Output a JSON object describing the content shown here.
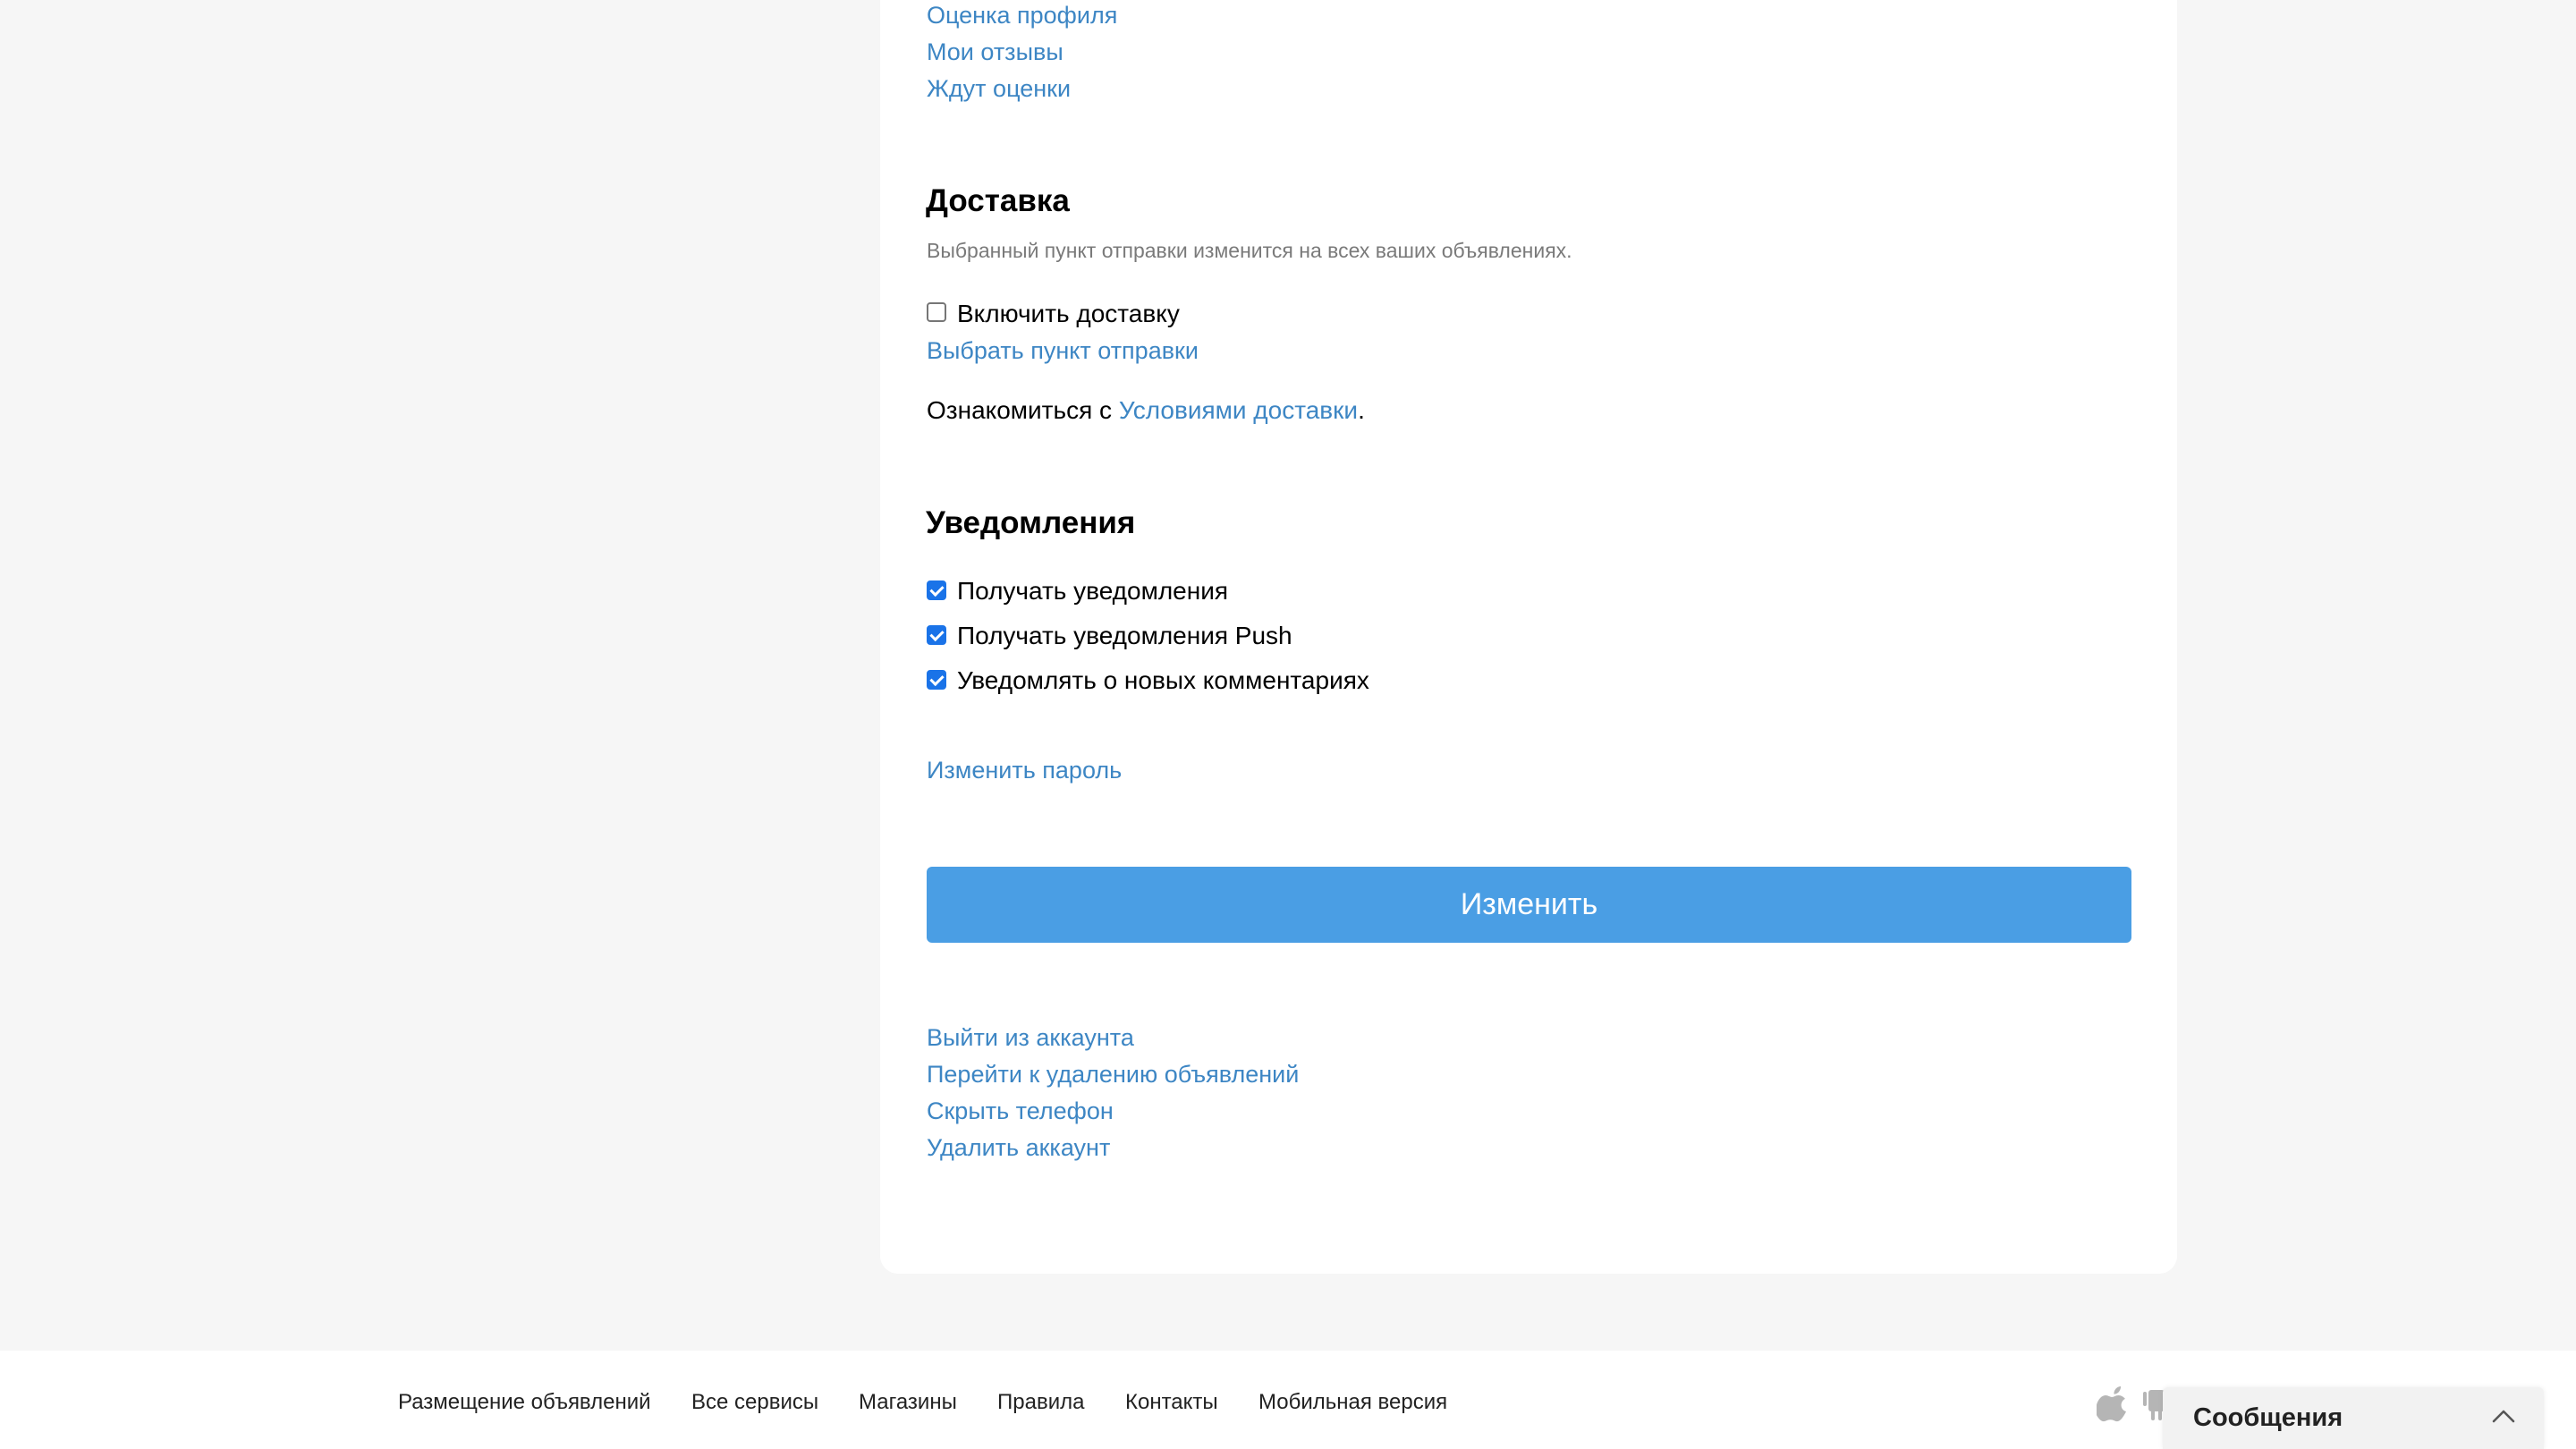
{
  "reviews": {
    "profile_rating": "Оценка профиля",
    "my_reviews": "Мои отзывы",
    "awaiting_rating": "Ждут оценки"
  },
  "delivery": {
    "title": "Доставка",
    "note": "Выбранный пункт отправки изменится на всех ваших объявлениях.",
    "enable_label": "Включить доставку",
    "enable_checked": false,
    "choose_point": "Выбрать пункт отправки",
    "terms_prefix": "Ознакомиться с ",
    "terms_link": "Условиями доставки",
    "terms_suffix": "."
  },
  "notifications": {
    "title": "Уведомления",
    "items": [
      {
        "label": "Получать уведомления",
        "checked": true
      },
      {
        "label": "Получать уведомления Push",
        "checked": true
      },
      {
        "label": "Уведомлять о новых комментариях",
        "checked": true
      }
    ]
  },
  "change_password": "Изменить пароль",
  "submit_label": "Изменить",
  "account_links": {
    "logout": "Выйти из аккаунта",
    "delete_ads": "Перейти к удалению объявлений",
    "hide_phone": "Скрыть телефон",
    "delete_account": "Удалить аккаунт"
  },
  "footer": {
    "links": [
      "Размещение объявлений",
      "Все сервисы",
      "Магазины",
      "Правила",
      "Контакты",
      "Мобильная версия"
    ]
  },
  "messages": {
    "title": "Сообщения"
  },
  "icons": {
    "apple": "apple-icon",
    "android": "android-icon",
    "chevron": "chevron-up-icon"
  },
  "colors": {
    "link": "#3d86c4",
    "button": "#4a9ee4",
    "checkbox": "#1a73e8",
    "page_bg": "#f6f6f6"
  }
}
